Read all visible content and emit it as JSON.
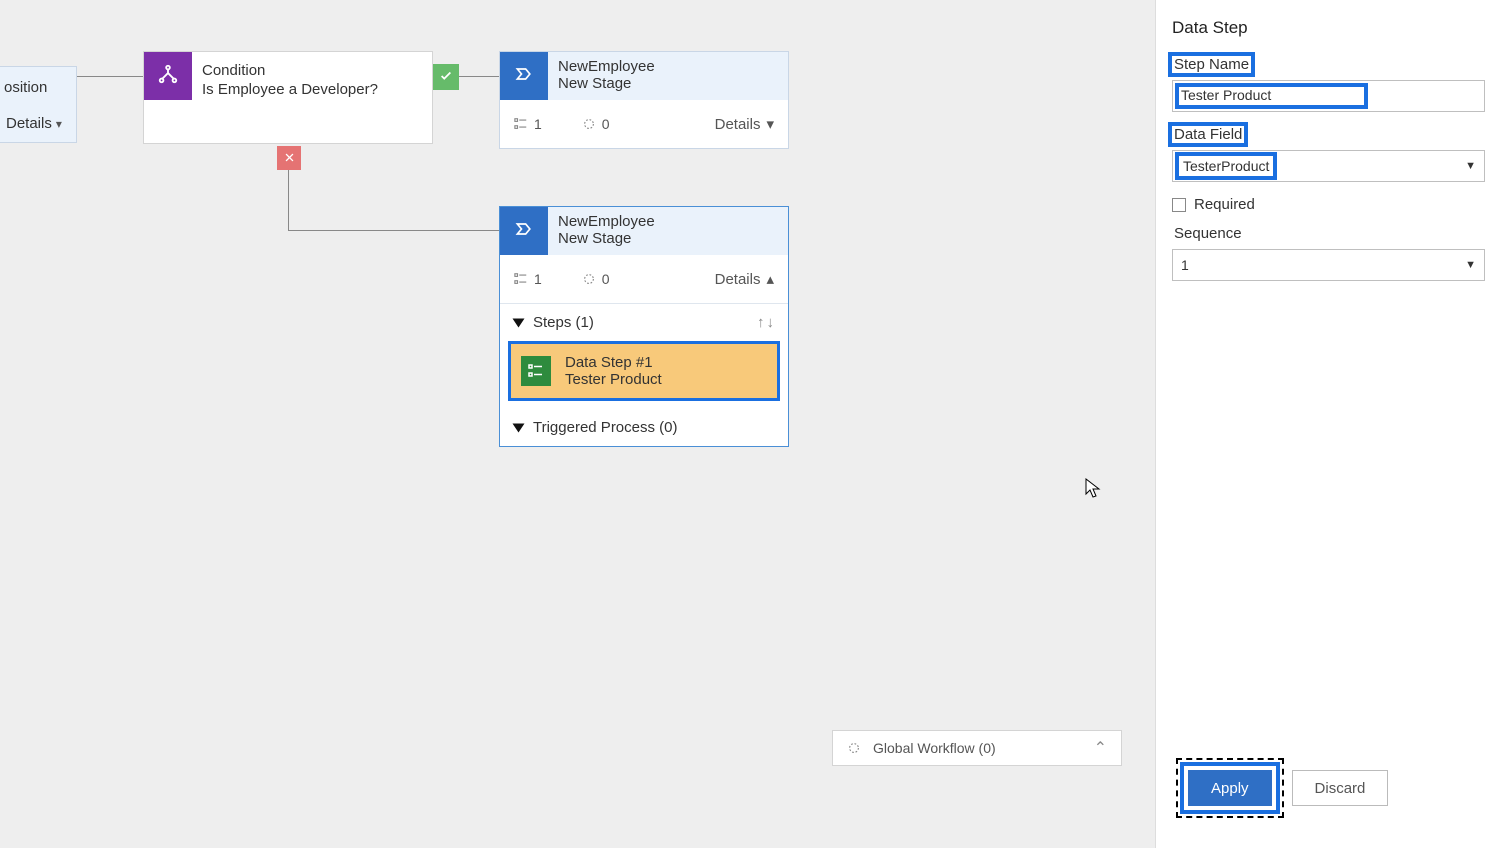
{
  "canvas": {
    "partial_node": {
      "title": "osition",
      "details": "Details"
    },
    "condition": {
      "badge": "Condition",
      "question": "Is Employee a Developer?"
    },
    "stage1": {
      "entity": "NewEmployee",
      "name": "New Stage",
      "steps_count": "1",
      "triggers_count": "0",
      "details": "Details"
    },
    "stage2": {
      "entity": "NewEmployee",
      "name": "New Stage",
      "steps_count": "1",
      "triggers_count": "0",
      "details": "Details",
      "steps_header": "Steps (1)",
      "step1_title": "Data Step #1",
      "step1_sub": "Tester Product",
      "trig_header": "Triggered Process (0)"
    }
  },
  "tray": {
    "label": "Global Workflow (0)"
  },
  "panel": {
    "title": "Data Step",
    "step_name_label": "Step Name",
    "step_name_value": "Tester Product",
    "data_field_label": "Data Field",
    "data_field_value": "TesterProduct",
    "required_label": "Required",
    "sequence_label": "Sequence",
    "sequence_value": "1",
    "apply": "Apply",
    "discard": "Discard"
  }
}
